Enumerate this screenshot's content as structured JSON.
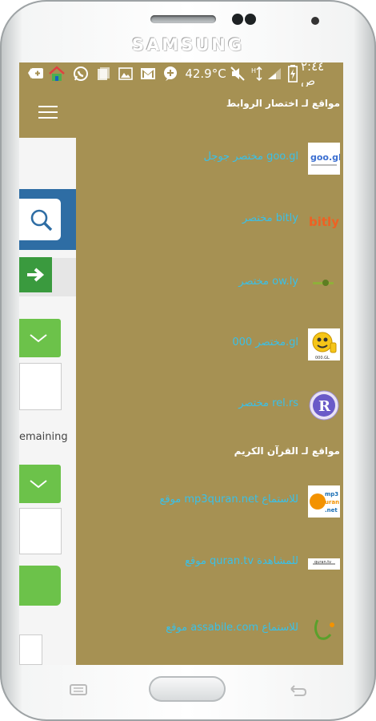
{
  "device": {
    "brand": "SAMSUNG"
  },
  "status_bar": {
    "time": "٢:٤٤ ص",
    "temperature": "42.9°C"
  },
  "background_app": {
    "remaining_text": "emaining"
  },
  "drawer": {
    "section1_title": "مواقع لـ اختصار الروابط",
    "shorteners": [
      {
        "label": "مختصر جوجل goo.gl",
        "icon": "googl-logo-icon"
      },
      {
        "label": "مختصر bitly",
        "icon": "bitly-logo-icon"
      },
      {
        "label": "مختصر ow.ly",
        "icon": "owly-logo-icon"
      },
      {
        "label": "مختصر 000.gl",
        "icon": "smiley-thumbsup-icon"
      },
      {
        "label": "مختصر rel.rs",
        "icon": "r-badge-icon"
      }
    ],
    "section2_title": "مواقع لـ القرآن الكريم",
    "quran_sites": [
      {
        "label": "موقع mp3quran.net للاستماع",
        "icon": "mp3quran-logo-icon"
      },
      {
        "label": "موقع quran.tv للمشاهدة",
        "icon": "qurantv-logo-icon"
      },
      {
        "label": "موقع assabile.com للاستماع",
        "icon": "assabile-logo-icon"
      }
    ]
  },
  "colors": {
    "drawer_bg": "#a69153",
    "link": "#3ac0e8",
    "green": "#6cc24a",
    "blue": "#2e6da4"
  }
}
